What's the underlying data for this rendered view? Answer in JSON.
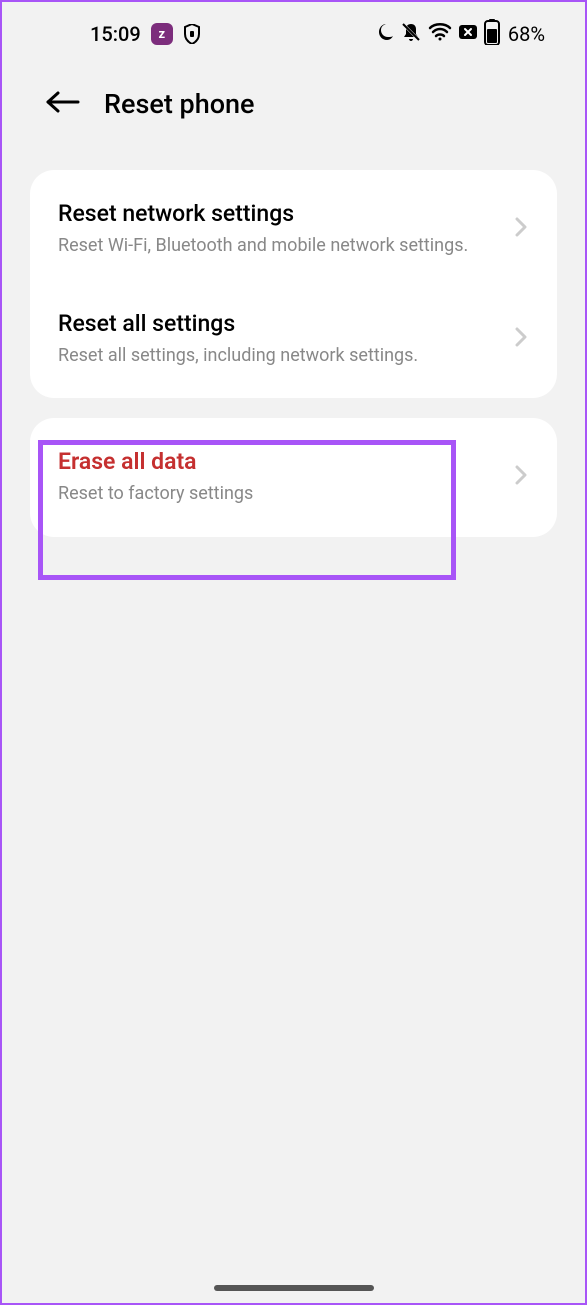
{
  "statusBar": {
    "time": "15:09",
    "zBadge": "z",
    "batteryPercent": "68%"
  },
  "header": {
    "title": "Reset phone"
  },
  "group1": {
    "item1": {
      "title": "Reset network settings",
      "subtitle": "Reset Wi-Fi, Bluetooth and mobile network settings."
    },
    "item2": {
      "title": "Reset all settings",
      "subtitle": "Reset all settings, including network settings."
    }
  },
  "group2": {
    "item1": {
      "title": "Erase all data",
      "subtitle": "Reset to factory settings"
    }
  }
}
